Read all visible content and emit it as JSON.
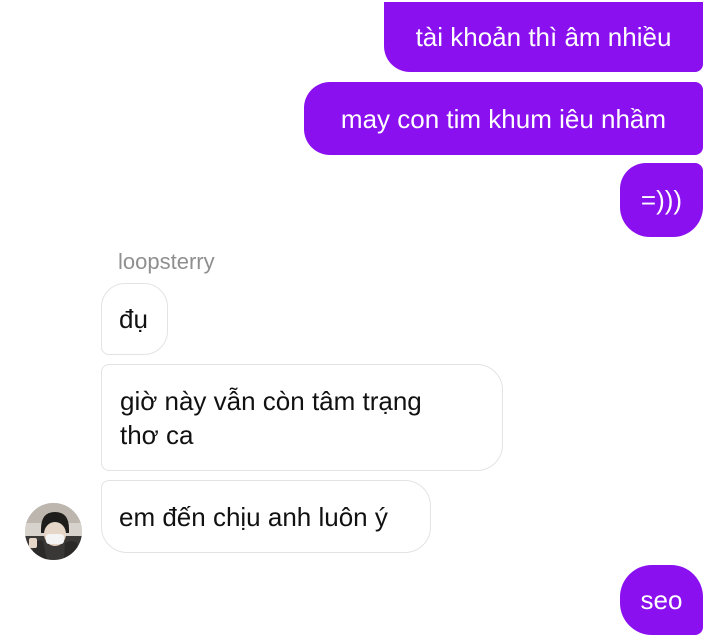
{
  "messages": {
    "outgoing": [
      "tài khoản thì âm nhiều",
      "may con tim khum iêu nhầm",
      "=)))",
      "seo"
    ],
    "incoming": {
      "sender": "loopsterry",
      "texts": [
        "đụ",
        "giờ này vẫn còn tâm trạng thơ ca",
        "em đến chịu anh luôn ý"
      ]
    }
  },
  "colors": {
    "outgoing_bubble": "#8a10f0",
    "incoming_border": "#e3e3e3",
    "sender_name": "#8f8f8f"
  }
}
